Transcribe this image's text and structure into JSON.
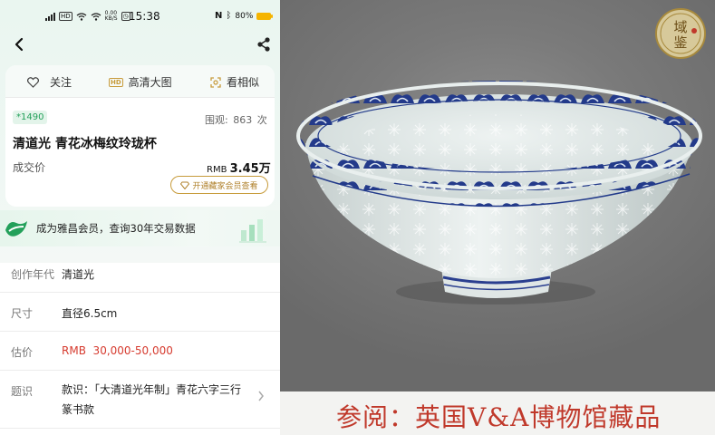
{
  "status_bar": {
    "time": "15:38",
    "battery": "80%",
    "speed_top": "0.00",
    "speed_unit": "KB/S"
  },
  "actions": {
    "follow": "关注",
    "hd": "高清大图",
    "hd_badge": "HD",
    "similar": "看相似"
  },
  "lot": {
    "number": "*1490",
    "views_label": "围观:",
    "views_value": "863",
    "views_unit": "次",
    "title": "清道光 青花冰梅纹玲珑杯",
    "deal_label": "成交价",
    "price_currency": "RMB",
    "price_value": "3.45万",
    "vip_button": "开通藏家会员查看"
  },
  "member_banner": {
    "text": "成为雅昌会员，查询30年交易数据"
  },
  "details": [
    {
      "label": "创作年代",
      "value": "清道光"
    },
    {
      "label": "尺寸",
      "value": "直径6.5cm"
    },
    {
      "label": "估价",
      "value": "RMB  30,000-50,000"
    },
    {
      "label": "题识",
      "value": "款识：「大清道光年制」青花六字三行篆书款"
    }
  ],
  "photo": {
    "caption": "参阅：英国V&A博物馆藏品",
    "seal_text": "域鉴"
  },
  "colors": {
    "accent_green": "#23a05a",
    "gold": "#c79b3b",
    "estimate_red": "#d63b2f",
    "caption_red": "#c0392b"
  }
}
